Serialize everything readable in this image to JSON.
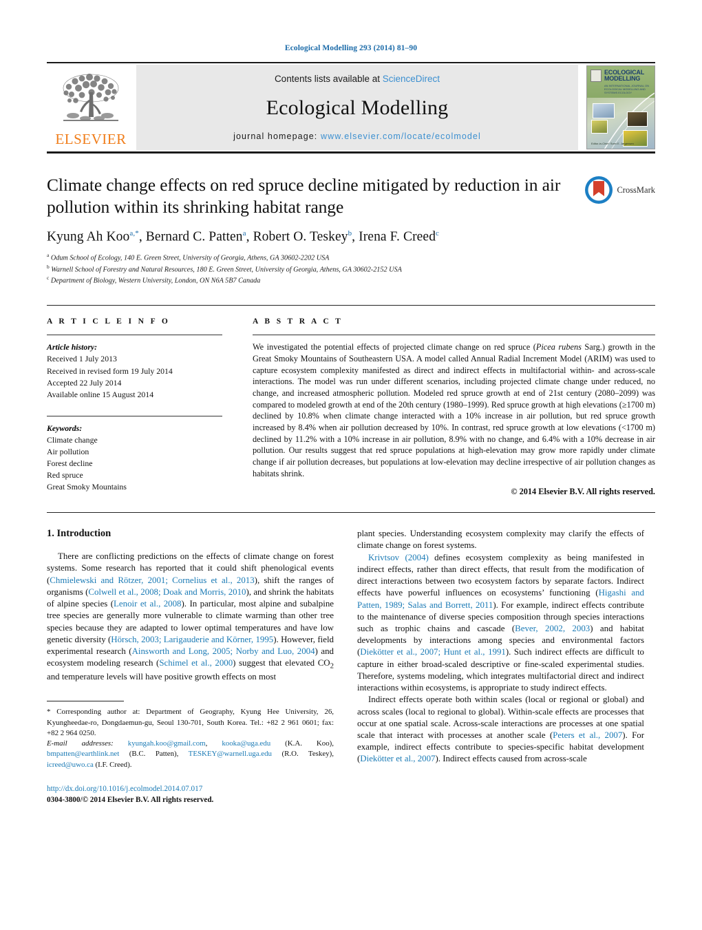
{
  "running_head": "Ecological Modelling 293 (2014) 81–90",
  "banner": {
    "publisher_name": "ELSEVIER",
    "contents_prefix": "Contents lists available at ",
    "contents_link": "ScienceDirect",
    "journal_name": "Ecological Modelling",
    "homepage_prefix": "journal homepage: ",
    "homepage_url": "www.elsevier.com/locate/ecolmodel",
    "cover": {
      "title_line1": "ECOLOGICAL",
      "title_line2": "MODELLING",
      "subtitle": "AN INTERNATIONAL JOURNAL ON ECOLOGICAL MODELLING AND SYSTEMS ECOLOGY",
      "footer": "Editor-in-Chief: Sven E. Jørgensen"
    }
  },
  "article": {
    "title": "Climate change effects on red spruce decline mitigated by reduction in air pollution within its shrinking habitat range",
    "crossmark_label": "CrossMark",
    "authors_html": "Kyung Ah Koo<sup>a,*</sup>, Bernard C. Patten<sup>a</sup>, Robert O. Teskey<sup>b</sup>, Irena F. Creed<sup>c</sup>",
    "affiliations": [
      {
        "mark": "a",
        "text": "Odum School of Ecology, 140 E. Green Street, University of Georgia, Athens, GA 30602-2202 USA"
      },
      {
        "mark": "b",
        "text": "Warnell School of Forestry and Natural Resources, 180 E. Green Street, University of Georgia, Athens, GA 30602-2152 USA"
      },
      {
        "mark": "c",
        "text": "Department of Biology, Western University, London, ON N6A 5B7 Canada"
      }
    ]
  },
  "article_info": {
    "heading": "A R T I C L E   I N F O",
    "history_label": "Article history:",
    "history": [
      "Received 1 July 2013",
      "Received in revised form 19 July 2014",
      "Accepted 22 July 2014",
      "Available online 15 August 2014"
    ],
    "keywords_label": "Keywords:",
    "keywords": [
      "Climate change",
      "Air pollution",
      "Forest decline",
      "Red spruce",
      "Great Smoky Mountains"
    ]
  },
  "abstract": {
    "heading": "A B S T R A C T",
    "text_html": "We investigated the potential effects of projected climate change on red spruce (<i>Picea rubens</i> Sarg.) growth in the Great Smoky Mountains of Southeastern USA. A model called Annual Radial Increment Model (ARIM) was used to capture ecosystem complexity manifested as direct and indirect effects in multifactorial within- and across-scale interactions. The model was run under different scenarios, including projected climate change under reduced, no change, and increased atmospheric pollution. Modeled red spruce growth at end of 21st century (2080–2099) was compared to modeled growth at end of the 20th century (1980–1999). Red spruce growth at high elevations (&ge;1700 m) declined by 10.8% when climate change interacted with a 10% increase in air pollution, but red spruce growth increased by 8.4% when air pollution decreased by 10%. In contrast, red spruce growth at low elevations (&lt;1700 m) declined by 11.2% with a 10% increase in air pollution, 8.9% with no change, and 6.4% with a 10% decrease in air pollution. Our results suggest that red spruce populations at high-elevation may grow more rapidly under climate change if air pollution decreases, but populations at low-elevation may decline irrespective of air pollution changes as habitats shrink.",
    "copyright": "© 2014 Elsevier B.V. All rights reserved."
  },
  "body": {
    "section_heading": "1.  Introduction",
    "left_paragraphs_html": [
      "There are conflicting predictions on the effects of climate change on forest systems. Some research has reported that it could shift phenological events (<span class=\"ref\">Chmielewski and Rötzer, 2001; Cornelius et al., 2013</span>), shift the ranges of organisms (<span class=\"ref\">Colwell et al., 2008; Doak and Morris, 2010</span>), and shrink the habitats of alpine species (<span class=\"ref\">Lenoir et al., 2008</span>). In particular, most alpine and subalpine tree species are generally more vulnerable to climate warming than other tree species because they are adapted to lower optimal temperatures and have low genetic diversity (<span class=\"ref\">Hörsch, 2003; Larigauderie and Körner, 1995</span>). However, field experimental research (<span class=\"ref\">Ainsworth and Long, 2005; Norby and Luo, 2004</span>) and ecosystem modeling research (<span class=\"ref\">Schimel et al., 2000</span>) suggest that elevated CO<sub>2</sub> and temperature levels will have positive growth effects on most"
    ],
    "right_paragraphs_html": [
      "plant species. Understanding ecosystem complexity may clarify the effects of climate change on forest systems.",
      "<span class=\"ref\">Krivtsov (2004)</span> defines ecosystem complexity as being manifested in indirect effects, rather than direct effects, that result from the modification of direct interactions between two ecosystem factors by separate factors. Indirect effects have powerful influences on ecosystems’ functioning (<span class=\"ref\">Higashi and Patten, 1989; Salas and Borrett, 2011</span>). For example, indirect effects contribute to the maintenance of diverse species composition through species interactions such as trophic chains and cascade (<span class=\"ref\">Bever, 2002, 2003</span>) and habitat developments by interactions among species and environmental factors (<span class=\"ref\">Diekötter et al., 2007; Hunt et al., 1991</span>). Such indirect effects are difficult to capture in either broad-scaled descriptive or fine-scaled experimental studies. Therefore, systems modeling, which integrates multifactorial direct and indirect interactions within ecosystems, is appropriate to study indirect effects.",
      "Indirect effects operate both within scales (local or regional or global) and across scales (local to regional to global). Within-scale effects are processes that occur at one spatial scale. Across-scale interactions are processes at one spatial scale that interact with processes at another scale (<span class=\"ref\">Peters et al., 2007</span>). For example, indirect effects contribute to species-specific habitat development (<span class=\"ref\">Diekötter et al., 2007</span>). Indirect effects caused from across-scale"
    ]
  },
  "footnote": {
    "corresponding_html": "<span class=\"star\">*</span> Corresponding author at: Department of Geography, Kyung Hee University, 26, Kyungheedae-ro, Dongdaemun-gu, Seoul 130-701, South Korea. Tel.: +82 2 961 0601; fax: +82 2 964 0250.",
    "emails_html": "<span class=\"it\">E-mail addresses:</span> <span class=\"lnk\">kyungah.koo@gmail.com</span>, <span class=\"lnk\">kooka@uga.edu</span> (K.A. Koo), <span class=\"lnk\">bmpatten@earthlink.net</span> (B.C. Patten), <span class=\"lnk\">TESKEY@warnell.uga.edu</span> (R.O. Teskey), <span class=\"lnk\">icreed@uwo.ca</span> (I.F. Creed).",
    "doi": "http://dx.doi.org/10.1016/j.ecolmodel.2014.07.017",
    "issn": "0304-3800/© 2014 Elsevier B.V. All rights reserved."
  },
  "colors": {
    "link_blue": "#1a7ab5",
    "header_blue": "#1a6aa8",
    "elsevier_orange": "#f07d1a",
    "banner_gray": "#e8e8e8"
  }
}
